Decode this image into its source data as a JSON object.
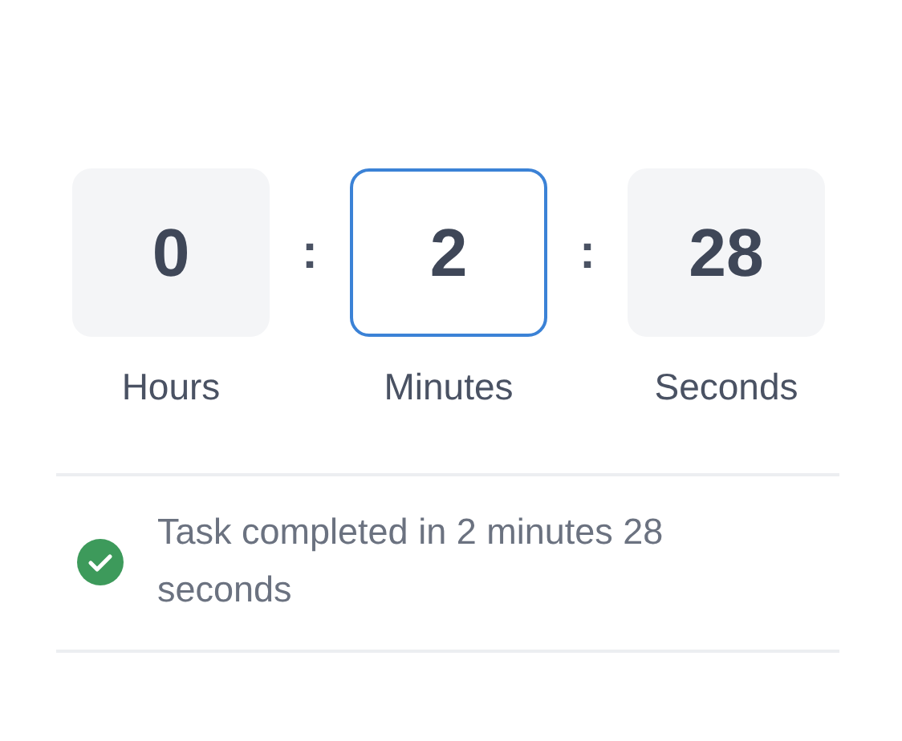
{
  "units": [
    {
      "value": "0",
      "label": "Hours",
      "selected": false
    },
    {
      "value": "2",
      "label": "Minutes",
      "selected": true
    },
    {
      "value": "28",
      "label": "Seconds",
      "selected": false
    }
  ],
  "separators": [
    ":",
    ":"
  ],
  "status": {
    "kind": "success",
    "text": "Task completed in 2 minutes 28 seconds"
  }
}
